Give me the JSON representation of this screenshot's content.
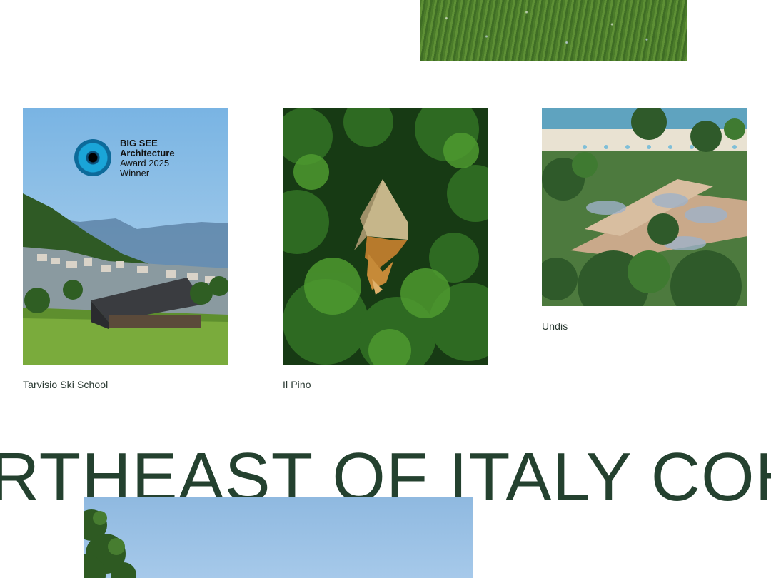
{
  "cards": [
    {
      "caption": "Tarvisio Ski School",
      "award": {
        "line1": "BIG SEE",
        "line2": "Architecture",
        "line3": "Award 2025",
        "line4": "Winner"
      }
    },
    {
      "caption": "Il Pino"
    },
    {
      "caption": "Undis"
    }
  ],
  "marquee": {
    "text": "RTHEAST OF ITALY  COH"
  },
  "colors": {
    "accent": "#24412f",
    "caption": "#2b3a33"
  }
}
